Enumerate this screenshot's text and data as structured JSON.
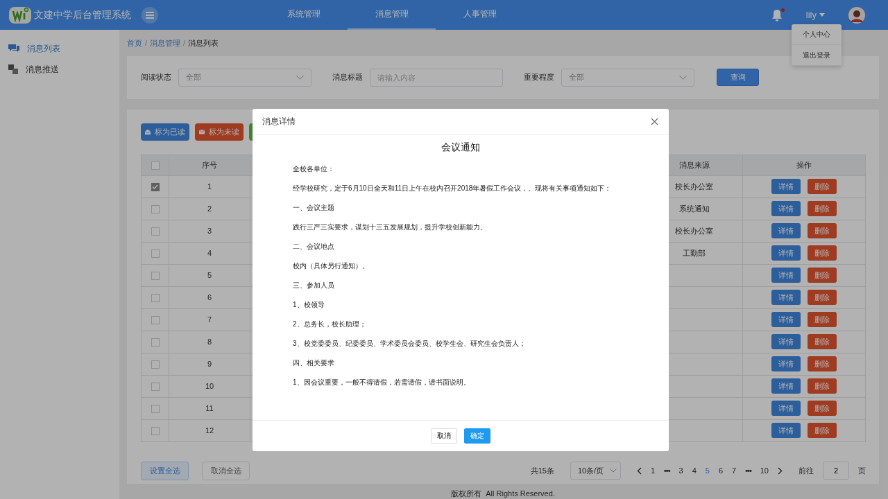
{
  "app": {
    "title": "文建中学后台管理系统"
  },
  "top_nav": [
    {
      "label": "系统管理",
      "selected": false
    },
    {
      "label": "消息管理",
      "selected": true
    },
    {
      "label": "人事管理",
      "selected": false
    }
  ],
  "notifications": {
    "unread": true
  },
  "user": {
    "name": "lily"
  },
  "user_menu": [
    "个人中心",
    "退出登录"
  ],
  "sidebar": [
    {
      "label": "消息列表",
      "kind": "chat",
      "selected": true
    },
    {
      "label": "消息推送",
      "kind": "squares",
      "selected": false
    }
  ],
  "breadcrumb": [
    {
      "label": "首页",
      "separator": "/"
    },
    {
      "label": "消息管理",
      "separator": "/"
    },
    {
      "label": "消息列表"
    }
  ],
  "filters": [
    {
      "kind": "select",
      "label": "阅读状态",
      "value": "全部"
    },
    {
      "kind": "input",
      "label": "消息标题",
      "placeholder": "请输入内容"
    },
    {
      "kind": "select",
      "label": "重要程度",
      "value": "全部"
    }
  ],
  "query_button": "查询",
  "toolbar": [
    {
      "kind": "read",
      "label": "标为已读"
    },
    {
      "kind": "unread",
      "label": "标为未读"
    },
    {
      "kind": "other"
    }
  ],
  "table": {
    "header_checked": false,
    "columns": [
      "序号",
      "消息来源",
      "操作"
    ],
    "rows": [
      {
        "index": "1",
        "source": "校长办公室",
        "checked": true,
        "actions": [
          "详情",
          "删除"
        ]
      },
      {
        "index": "2",
        "source": "系统通知",
        "checked": false,
        "actions": [
          "详情",
          "删除"
        ]
      },
      {
        "index": "3",
        "source": "校长办公室",
        "checked": false,
        "actions": [
          "详情",
          "删除"
        ]
      },
      {
        "index": "4",
        "source": "工勤部",
        "checked": false,
        "actions": [
          "详情",
          "删除"
        ]
      },
      {
        "index": "5",
        "checked": false,
        "actions": [
          "详情",
          "删除"
        ]
      },
      {
        "index": "6",
        "checked": false,
        "actions": [
          "详情",
          "删除"
        ]
      },
      {
        "index": "7",
        "checked": false,
        "actions": [
          "详情",
          "删除"
        ]
      },
      {
        "index": "8",
        "checked": false,
        "actions": [
          "详情",
          "删除"
        ]
      },
      {
        "index": "9",
        "checked": false,
        "actions": [
          "详情",
          "删除"
        ]
      },
      {
        "index": "10",
        "checked": false,
        "actions": [
          "详情",
          "删除"
        ]
      },
      {
        "index": "11",
        "checked": false,
        "actions": [
          "详情",
          "删除"
        ]
      },
      {
        "index": "12",
        "checked": false,
        "actions": [
          "详情",
          "删除"
        ]
      }
    ]
  },
  "bulk_buttons": [
    {
      "label": "设置全选",
      "kind": "primary"
    },
    {
      "label": "取消全选",
      "kind": "plain"
    }
  ],
  "pagination": {
    "total": "共15条",
    "page_size": "10条/页",
    "pages": [
      {
        "label": "1",
        "kind": "page",
        "selected": false
      },
      {
        "label": "•••",
        "kind": "more",
        "selected": false
      },
      {
        "label": "3",
        "kind": "page",
        "selected": false
      },
      {
        "label": "4",
        "kind": "page",
        "selected": false
      },
      {
        "label": "5",
        "kind": "page",
        "selected": true
      },
      {
        "label": "6",
        "kind": "page",
        "selected": false
      },
      {
        "label": "7",
        "kind": "page",
        "selected": false
      },
      {
        "label": "•••",
        "kind": "more",
        "selected": false
      },
      {
        "label": "10",
        "kind": "page",
        "selected": false
      }
    ],
    "goto_label": "前往",
    "goto_value": "2",
    "goto_suffix": "页"
  },
  "footer": "版权所有  All Rights Reserved.",
  "dialog": {
    "title": "消息详情",
    "heading": "会议通知",
    "paragraphs": [
      "全校各单位：",
      "经学校研究，定于6月10日全天和11日上午在校内召开2018年暑假工作会议，。现将有关事项通知如下：",
      "一、会议主题",
      "践行三严三实要求，谋划十三五发展规划，提升学校创新能力。",
      "二、会议地点",
      "校内（具体另行通知）。",
      "三、参加人员",
      "1、校领导",
      "2、总务长，校长助理；",
      "3、校党委委员、纪委委员、学术委员会委员、校学生会、研究生会负责人；",
      "四、相关要求",
      "1、因会议重要，一般不得请假，若需请假，请书面说明。"
    ],
    "buttons": [
      {
        "label": "取消",
        "kind": "secondary"
      },
      {
        "label": "确定",
        "kind": "primary"
      }
    ]
  }
}
